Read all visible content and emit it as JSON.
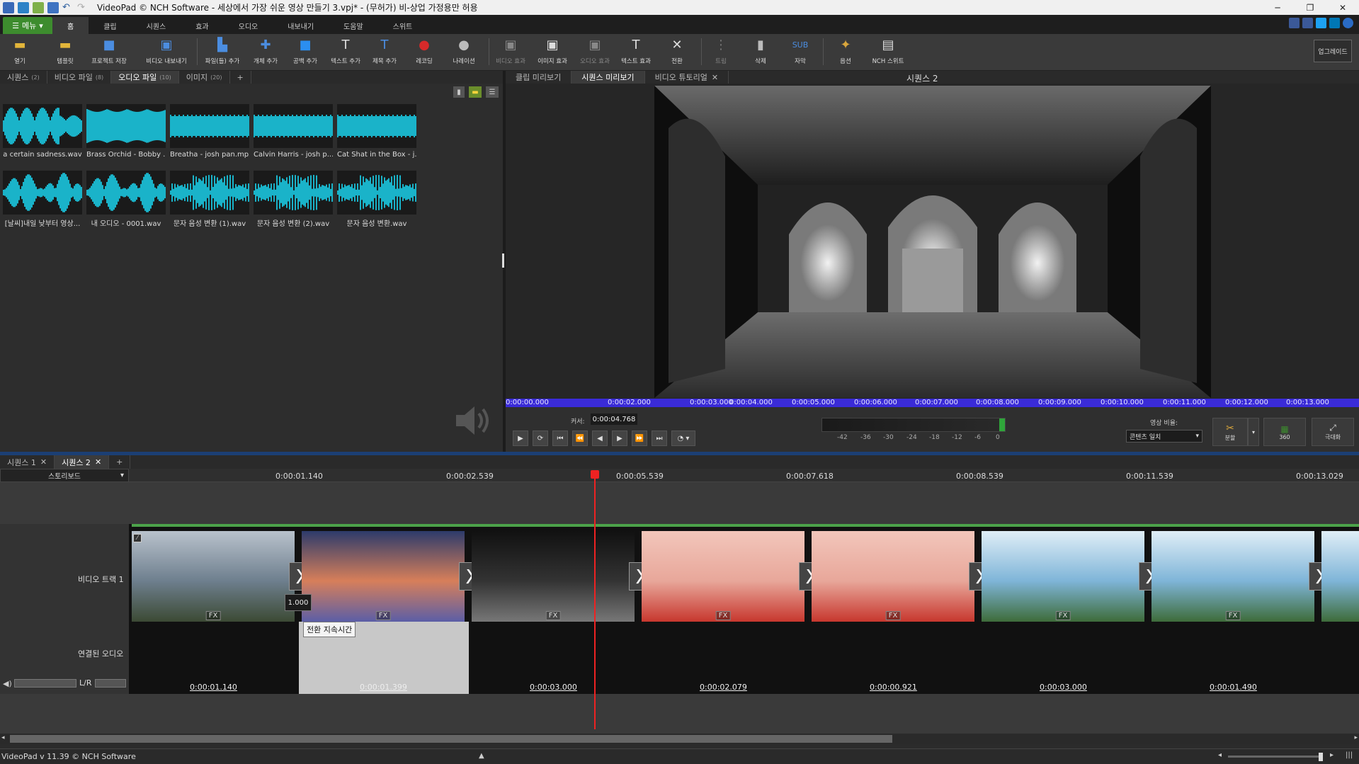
{
  "titlebar": {
    "title": "VideoPad © NCH Software - 세상에서 가장 쉬운 영상 만들기 3.vpj* - (무허가) 비-상업 가정용만 허용",
    "minimize": "─",
    "restore": "❐",
    "close": "✕"
  },
  "menu": {
    "menu_button": "메뉴",
    "tabs": [
      "홈",
      "클립",
      "시퀀스",
      "효과",
      "오디오",
      "내보내기",
      "도움말",
      "스위트"
    ]
  },
  "toolbar": {
    "items": [
      {
        "label": "열기",
        "icon": "folder-open-icon"
      },
      {
        "label": "템플릿",
        "icon": "template-folder-icon"
      },
      {
        "label": "프로젝트 저장",
        "icon": "save-icon"
      },
      {
        "label": "비디오 내보내기",
        "icon": "export-video-icon"
      },
      {
        "label": "파일(들) 추가",
        "icon": "add-file-icon"
      },
      {
        "label": "개체 추가",
        "icon": "add-object-icon"
      },
      {
        "label": "공백 추가",
        "icon": "add-blank-icon"
      },
      {
        "label": "텍스트 추가",
        "icon": "add-text-icon"
      },
      {
        "label": "제목 추가",
        "icon": "add-title-icon"
      },
      {
        "label": "레코딩",
        "icon": "record-icon"
      },
      {
        "label": "나레이션",
        "icon": "microphone-icon"
      },
      {
        "label": "비디오 효과",
        "icon": "video-effects-icon"
      },
      {
        "label": "이미지 효과",
        "icon": "image-effects-icon"
      },
      {
        "label": "오디오 효과",
        "icon": "audio-effects-icon"
      },
      {
        "label": "텍스트 효과",
        "icon": "text-effects-icon"
      },
      {
        "label": "전환",
        "icon": "transition-icon"
      },
      {
        "label": "트림",
        "icon": "trim-icon"
      },
      {
        "label": "삭제",
        "icon": "trash-icon"
      },
      {
        "label": "자막",
        "icon": "subtitle-icon"
      },
      {
        "label": "옵션",
        "icon": "options-icon"
      },
      {
        "label": "NCH 스위트",
        "icon": "suite-icon"
      }
    ],
    "upgrade": "업그레이드"
  },
  "bin": {
    "tabs": [
      {
        "label": "시퀀스",
        "count": "(2)"
      },
      {
        "label": "비디오 파일",
        "count": "(8)"
      },
      {
        "label": "오디오 파일",
        "count": "(10)"
      },
      {
        "label": "이미지",
        "count": "(20)"
      },
      {
        "label": "+",
        "count": ""
      }
    ],
    "clips": [
      "a certain sadness.wav",
      "Brass Orchid - Bobby ...",
      "Breatha - josh pan.mp3",
      "Calvin Harris - josh p...",
      "Cat Shat in the Box - j...",
      "[날씨]내일 낮부터 영상...",
      "내 오디오 - 0001.wav",
      "문자 음성 변환 (1).wav",
      "문자 음성 변환 (2).wav",
      "문자 음성 변환.wav"
    ]
  },
  "preview": {
    "tabs": [
      "클립 미리보기",
      "시퀀스 미리보기",
      "비디오 튜토리얼"
    ],
    "sequence_title": "시퀀스 2",
    "ruler": [
      "0:00:00.000",
      "0:00:02.000",
      "0:00:03.000",
      "0:00:04.000",
      "0:00:05.000",
      "0:00:06.000",
      "0:00:07.000",
      "0:00:08.000",
      "0:00:09.000",
      "0:00:10.000",
      "0:00:11.000",
      "0:00:12.000",
      "0:00:13.000"
    ],
    "cursor_label": "커서:",
    "cursor_value": "0:00:04.768",
    "meter_ticks": [
      "-42",
      "-36",
      "-30",
      "-24",
      "-18",
      "-12",
      "-6",
      "0"
    ],
    "aspect_label": "영상 비율:",
    "aspect_value": "콘텐츠 일치",
    "split_label": "분할",
    "btn_360": "360",
    "maximize_label": "극대화"
  },
  "timeline": {
    "tabs": [
      "시퀀스 1",
      "시퀀스 2",
      "+"
    ],
    "view_mode": "스토리보드",
    "ruler": [
      "0:00:01.140",
      "0:00:02.539",
      "0:00:05.539",
      "0:00:07.618",
      "0:00:08.539",
      "0:00:11.539",
      "0:00:13.029"
    ],
    "video_track_label": "비디오 트랙 1",
    "audio_track_label": "연결된 오디오",
    "lr_label": "L/R",
    "clip_durations": [
      "0:00:01.140",
      "0:00:01.399",
      "0:00:03.000",
      "0:00:02.079",
      "0:00:00.921",
      "0:00:03.000",
      "0:00:01.490"
    ],
    "fx_label": "FX",
    "transition_symbol": "X",
    "transition_duration": "1.000",
    "tooltip": "전환 지속시간"
  },
  "status": {
    "text": "VideoPad v 11.39 © NCH Software"
  },
  "colors": {
    "accent_green": "#3d8c2e",
    "ruler_blue": "#3a2bd8",
    "playhead_red": "#e22222",
    "waveform_cyan": "#1ab3c9"
  }
}
